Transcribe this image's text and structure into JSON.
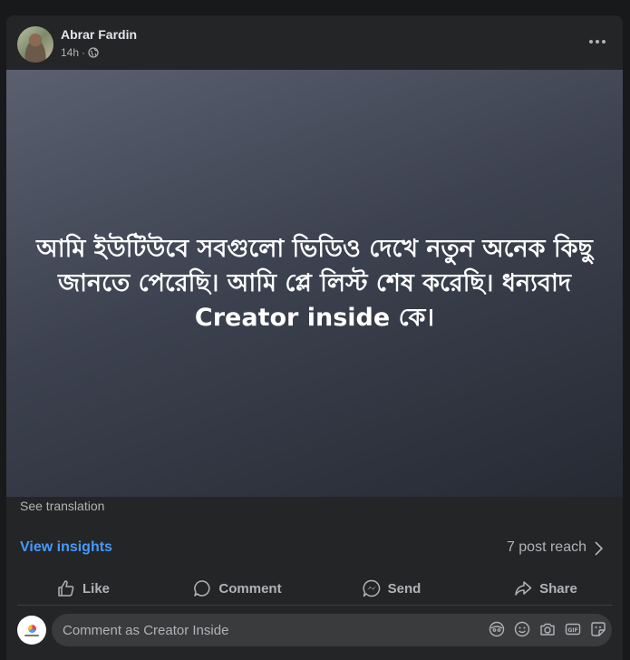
{
  "post": {
    "author": "Abrar Fardin",
    "time": "14h",
    "separator": "·",
    "text": "আমি ইউটিউবে সবগুলো ভিডিও দেখে নতুন অনেক কিছু জানতে পেরেছি। আমি প্লে লিস্ট শেষ করেছি। ধন্যবাদ Creator inside কে।",
    "see_translation": "See translation"
  },
  "insights": {
    "view_label": "View insights",
    "reach": "7 post reach"
  },
  "actions": {
    "like": "Like",
    "comment": "Comment",
    "send": "Send",
    "share": "Share"
  },
  "comment_composer": {
    "placeholder": "Comment as Creator Inside"
  },
  "icons": [
    "globe-icon",
    "more-icon",
    "chevron-right-icon",
    "like-icon",
    "comment-icon",
    "send-icon",
    "share-icon",
    "avatar-sticker-icon",
    "emoji-icon",
    "camera-icon",
    "gif-icon",
    "sticker-icon"
  ],
  "colors": {
    "background": "#18191a",
    "card": "#242526",
    "link": "#4599ff",
    "secondary_text": "#b0b3b8",
    "input_bg": "#3a3b3c"
  }
}
